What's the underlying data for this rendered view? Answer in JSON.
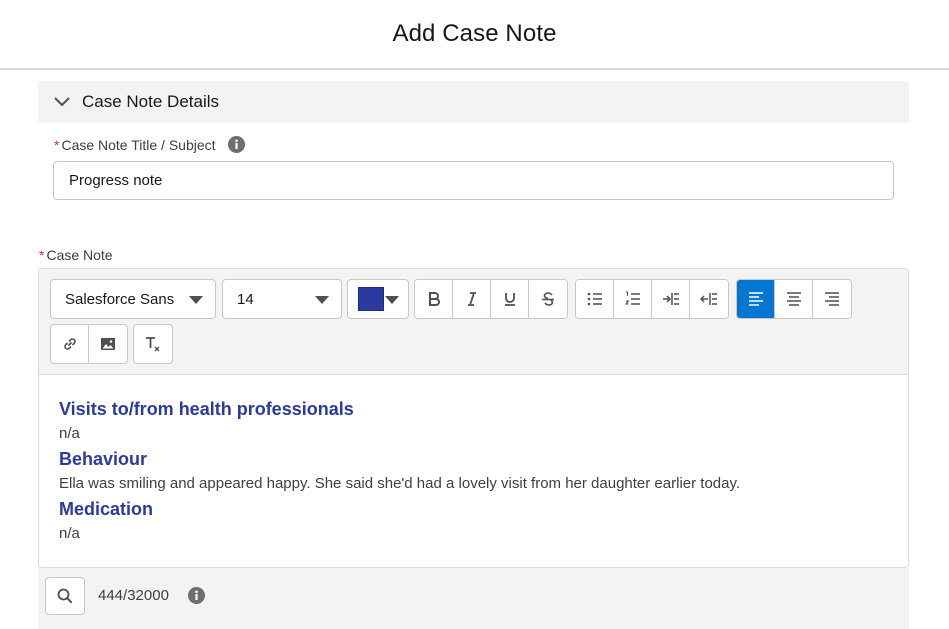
{
  "modal": {
    "title": "Add Case Note"
  },
  "section": {
    "title": "Case Note Details"
  },
  "title_field": {
    "required_marker": "*",
    "label": "Case Note Title / Subject",
    "value": "Progress note"
  },
  "note_field": {
    "required_marker": "*",
    "label": "Case Note"
  },
  "toolbar": {
    "font_family": "Salesforce Sans",
    "font_size": "14",
    "text_color": "#2b3a9f",
    "active_align": "align-left"
  },
  "content": {
    "heading1": "Visits to/from health professionals",
    "text1": "n/a",
    "heading2": "Behaviour",
    "text2": "Ella was smiling and appeared happy. She said she'd had a lovely visit from her daughter earlier today.",
    "heading3": "Medication",
    "text3": "n/a"
  },
  "footer": {
    "char_count": "444/32000"
  },
  "colors": {
    "accent": "#0176d3",
    "heading": "#2b3a9f",
    "required": "#c23934"
  }
}
